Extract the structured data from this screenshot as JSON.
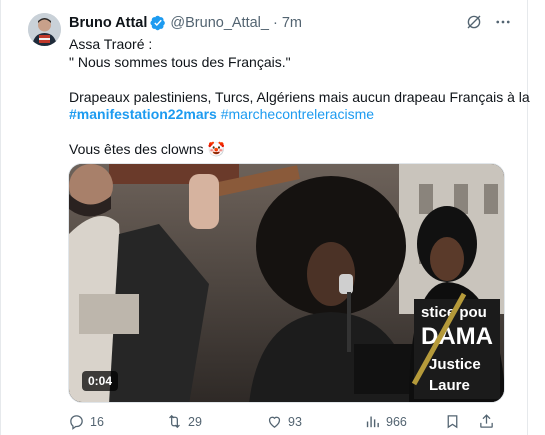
{
  "tweet": {
    "author": {
      "name": "Bruno Attal",
      "handle": "@Bruno_Attal_",
      "separator": "·",
      "time": "7m",
      "verified": true,
      "avatar_icon": "profile-photo"
    },
    "lines": [
      "Assa Traoré :",
      "\" Nous sommes tous des Français.\"",
      "",
      "Drapeaux palestiniens, Turcs, Algériens mais aucun drapeau Français à la",
      "",
      "",
      "Vous êtes des clowns 🤡"
    ],
    "hashtags": [
      "#manifestation22mars",
      "#marchecontreleracisme"
    ],
    "media": {
      "type": "video",
      "duration": "0:04",
      "sign_texts": [
        "stice pou",
        "DAMA",
        "Justice",
        "Laure"
      ]
    },
    "actions": {
      "replies": "16",
      "reposts": "29",
      "likes": "93",
      "views": "966"
    }
  },
  "colors": {
    "text": "#0f1419",
    "secondary": "#536471",
    "link": "#1d9bf0",
    "verified": "#1d9bf0"
  }
}
